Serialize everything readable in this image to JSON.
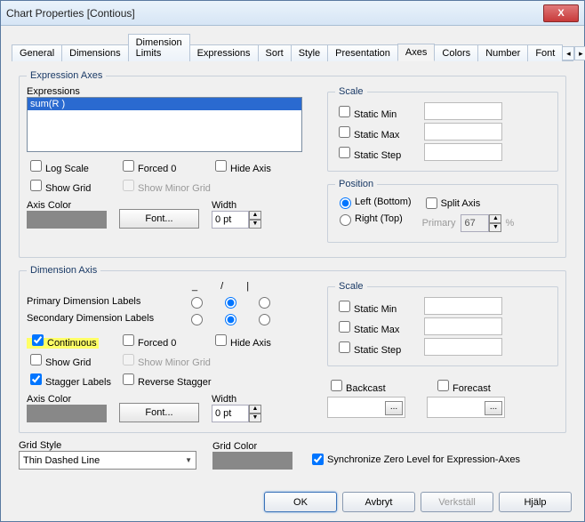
{
  "window": {
    "title": "Chart Properties [Contious]"
  },
  "tabs": [
    "General",
    "Dimensions",
    "Dimension Limits",
    "Expressions",
    "Sort",
    "Style",
    "Presentation",
    "Axes",
    "Colors",
    "Number",
    "Font"
  ],
  "activeTab": "Axes",
  "exprAxes": {
    "legend": "Expression Axes",
    "expressionsLabel": "Expressions",
    "listItem": "sum(R )",
    "logScale": "Log Scale",
    "forced0": "Forced 0",
    "hideAxis": "Hide Axis",
    "showGrid": "Show Grid",
    "showMinorGrid": "Show Minor Grid",
    "axisColor": "Axis Color",
    "fontBtn": "Font...",
    "widthLabel": "Width",
    "widthVal": "0 pt"
  },
  "scale1": {
    "legend": "Scale",
    "staticMin": "Static Min",
    "staticMax": "Static Max",
    "staticStep": "Static Step"
  },
  "position": {
    "legend": "Position",
    "left": "Left (Bottom)",
    "right": "Right (Top)",
    "splitAxis": "Split Axis",
    "primaryLabel": "Primary",
    "primaryVal": "67",
    "pct": "%"
  },
  "dimAxis": {
    "legend": "Dimension Axis",
    "h1": "_",
    "h2": "/",
    "h3": "|",
    "primaryDim": "Primary Dimension Labels",
    "secondaryDim": "Secondary Dimension Labels",
    "continuous": "Continuous",
    "forced0": "Forced 0",
    "hideAxis": "Hide Axis",
    "showGrid": "Show Grid",
    "showMinorGrid": "Show Minor Grid",
    "staggerLabels": "Stagger Labels",
    "reverseStagger": "Reverse Stagger",
    "axisColor": "Axis Color",
    "fontBtn": "Font...",
    "widthLabel": "Width",
    "widthVal": "0 pt"
  },
  "scale2": {
    "legend": "Scale",
    "staticMin": "Static Min",
    "staticMax": "Static Max",
    "staticStep": "Static Step"
  },
  "bf": {
    "backcast": "Backcast",
    "forecast": "Forecast"
  },
  "grid": {
    "styleLabel": "Grid Style",
    "styleVal": "Thin Dashed Line",
    "colorLabel": "Grid Color",
    "sync": "Synchronize Zero Level for Expression-Axes"
  },
  "buttons": {
    "ok": "OK",
    "cancel": "Avbryt",
    "apply": "Verkställ",
    "help": "Hjälp"
  }
}
